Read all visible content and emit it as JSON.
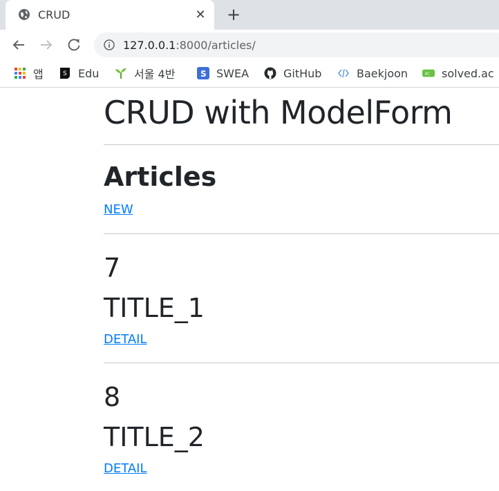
{
  "browser": {
    "tab_title": "CRUD",
    "close_glyph": "✕",
    "new_tab_glyph": "+",
    "url_host": "127.0.0.1",
    "url_path": ":8000/articles/",
    "bookmarks": [
      {
        "label": "앱",
        "icon": "apps-grid-icon"
      },
      {
        "label": "Edu",
        "icon": "edu-icon"
      },
      {
        "label": "서울 4반",
        "icon": "sprout-icon"
      },
      {
        "label": "SWEA",
        "icon": "swea-icon"
      },
      {
        "label": "GitHub",
        "icon": "github-icon"
      },
      {
        "label": "Baekjoon",
        "icon": "code-icon"
      },
      {
        "label": "solved.ac",
        "icon": "solved-ac-icon"
      }
    ]
  },
  "page": {
    "title": "CRUD with ModelForm",
    "section_title": "Articles",
    "new_link": "NEW",
    "articles": [
      {
        "id": "7",
        "title": "TITLE_1",
        "detail_link": "DETAIL"
      },
      {
        "id": "8",
        "title": "TITLE_2",
        "detail_link": "DETAIL"
      }
    ]
  },
  "colors": {
    "link": "#007bff",
    "text": "#212529",
    "tabstrip": "#dee1e6",
    "omnibox": "#f1f3f4"
  }
}
